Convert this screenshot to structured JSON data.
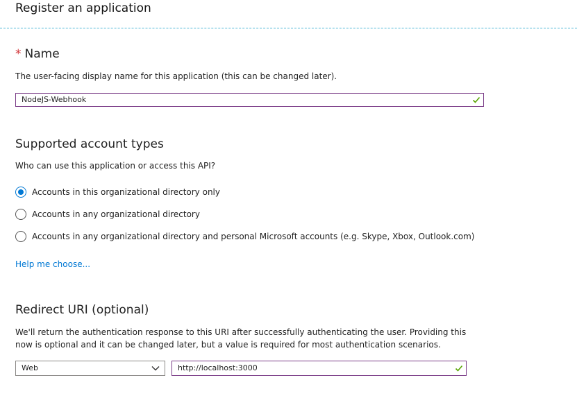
{
  "header": {
    "title": "Register an application"
  },
  "name_section": {
    "required_marker": "*",
    "title": "Name",
    "description": "The user-facing display name for this application (this can be changed later).",
    "value": "NodeJS-Webhook"
  },
  "account_types": {
    "title": "Supported account types",
    "description": "Who can use this application or access this API?",
    "options": [
      {
        "label": "Accounts in this organizational directory only",
        "selected": true
      },
      {
        "label": "Accounts in any organizational directory",
        "selected": false
      },
      {
        "label": "Accounts in any organizational directory and personal Microsoft accounts (e.g. Skype, Xbox, Outlook.com)",
        "selected": false
      }
    ],
    "help_link": "Help me choose..."
  },
  "redirect": {
    "title": "Redirect URI (optional)",
    "description": "We'll return the authentication response to this URI after successfully authenticating the user. Providing this now is optional and it can be changed later, but a value is required for most authentication scenarios.",
    "platform": "Web",
    "uri": "http://localhost:3000"
  },
  "colors": {
    "accent": "#0078d4",
    "valid_check": "#57a300",
    "field_border": "#7a3b87",
    "required": "#d13438",
    "divider": "#49b6d6"
  }
}
